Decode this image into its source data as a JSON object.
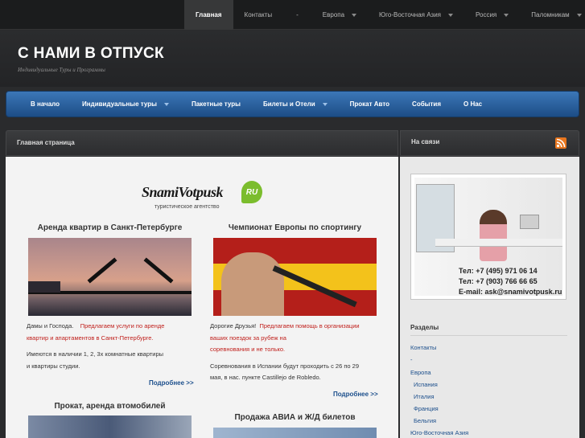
{
  "topnav": [
    {
      "label": "Главная",
      "active": true,
      "dropdown": false
    },
    {
      "label": "Контакты",
      "active": false,
      "dropdown": false
    },
    {
      "label": "-",
      "active": false,
      "dropdown": false
    },
    {
      "label": "Европа",
      "active": false,
      "dropdown": true
    },
    {
      "label": "Юго-Восточная Азия",
      "active": false,
      "dropdown": true
    },
    {
      "label": "Россия",
      "active": false,
      "dropdown": true
    },
    {
      "label": "Паломникам",
      "active": false,
      "dropdown": true
    }
  ],
  "site": {
    "title": "С НАМИ В ОТПУСК",
    "description": "Индивидуальные Туры и Программы"
  },
  "mainnav": [
    {
      "label": "В начало",
      "dropdown": false
    },
    {
      "label": "Индивидуальные туры",
      "dropdown": true
    },
    {
      "label": "Пакетные туры",
      "dropdown": false
    },
    {
      "label": "Билеты и Отели",
      "dropdown": true
    },
    {
      "label": "Прокат Авто",
      "dropdown": false
    },
    {
      "label": "События",
      "dropdown": false
    },
    {
      "label": "О Нас",
      "dropdown": false
    }
  ],
  "breadcrumb": "Главная страница",
  "sidebar_header": "На связи",
  "logo": {
    "text": "SnamiVotpusk",
    "badge": "RU",
    "subtitle": "туристическое агентство"
  },
  "posts": {
    "p1": {
      "title": "Аренда квартир в Санкт-Петербурге",
      "t1a": "Дамы и Господа.",
      "t1b": "Предлагаем услуги по аренде",
      "t2": "квартир и апартаментов в Санкт-Петербурге.",
      "t3": "Имеются в наличии  1,  2,  3х комнатные квартиры",
      "t4": "и квартиры студии.",
      "more": "Подробнее >>"
    },
    "p2": {
      "title": "Чемпионат Европы по спортингу",
      "t1a": "Дорогие Друзья!",
      "t1b": "Предлагаем помощь в организации",
      "t2": "ваших поездок за рубеж на",
      "t3": "соревнования и не только.",
      "t4": "Соревнования в Испании будут проходить с 26 по 29",
      "t5": "мая, в нас. пункте Castillejo de Robledo.",
      "more": "Подробнее >>"
    },
    "p3": {
      "title": "Прокат, аренда втомобилей"
    },
    "p4": {
      "title": "Продажа АВИА и Ж/Д билетов"
    }
  },
  "contact": {
    "phone1": "Тел: +7 (495) 971 06 14",
    "phone2": "Тел: +7 (903) 766 66 65",
    "email": "E-mail: ask@snamivotpusk.ru"
  },
  "sections": {
    "title": "Разделы",
    "items": [
      "Контакты",
      "-",
      "Европа",
      "Испания",
      "Италия",
      "Франция",
      "Бельгия",
      "Юго-Восточная Азия"
    ]
  },
  "colors": {
    "accent": "#2c62a3",
    "link": "#1c4f8c",
    "highlight": "#c0201c",
    "rss": "#e8761e"
  }
}
